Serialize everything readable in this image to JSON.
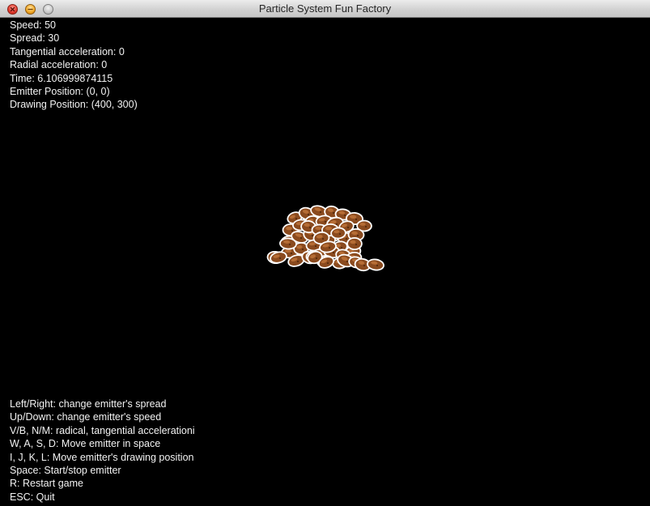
{
  "window": {
    "title": "Particle System Fun Factory",
    "controls": [
      "close",
      "minimize",
      "zoom"
    ]
  },
  "stats": [
    {
      "label": "Speed",
      "value": "50"
    },
    {
      "label": "Spread",
      "value": "30"
    },
    {
      "label": "Tangential acceleration",
      "value": "0"
    },
    {
      "label": "Radial acceleration",
      "value": "0"
    },
    {
      "label": "Time",
      "value": "6.106999874115"
    },
    {
      "label": "Emitter Position",
      "value": "(0, 0)"
    },
    {
      "label": "Drawing Position",
      "value": "(400, 300)"
    }
  ],
  "help": [
    "Left/Right: change emitter's spread",
    "Up/Down: change emitter's speed",
    "V/B, N/M: radical, tangential accelerationi",
    "W, A, S, D: Move emitter in space",
    "I, J, K, L: Move emitter's drawing position",
    "Space: Start/stop emitter",
    "R: Restart game",
    "ESC: Quit"
  ],
  "colors": {
    "background": "#000000",
    "text": "#f2f2f2",
    "particle_fill": "#8a4a1e",
    "particle_outline": "#ffffff"
  },
  "particle_sprite": "potato-particle"
}
